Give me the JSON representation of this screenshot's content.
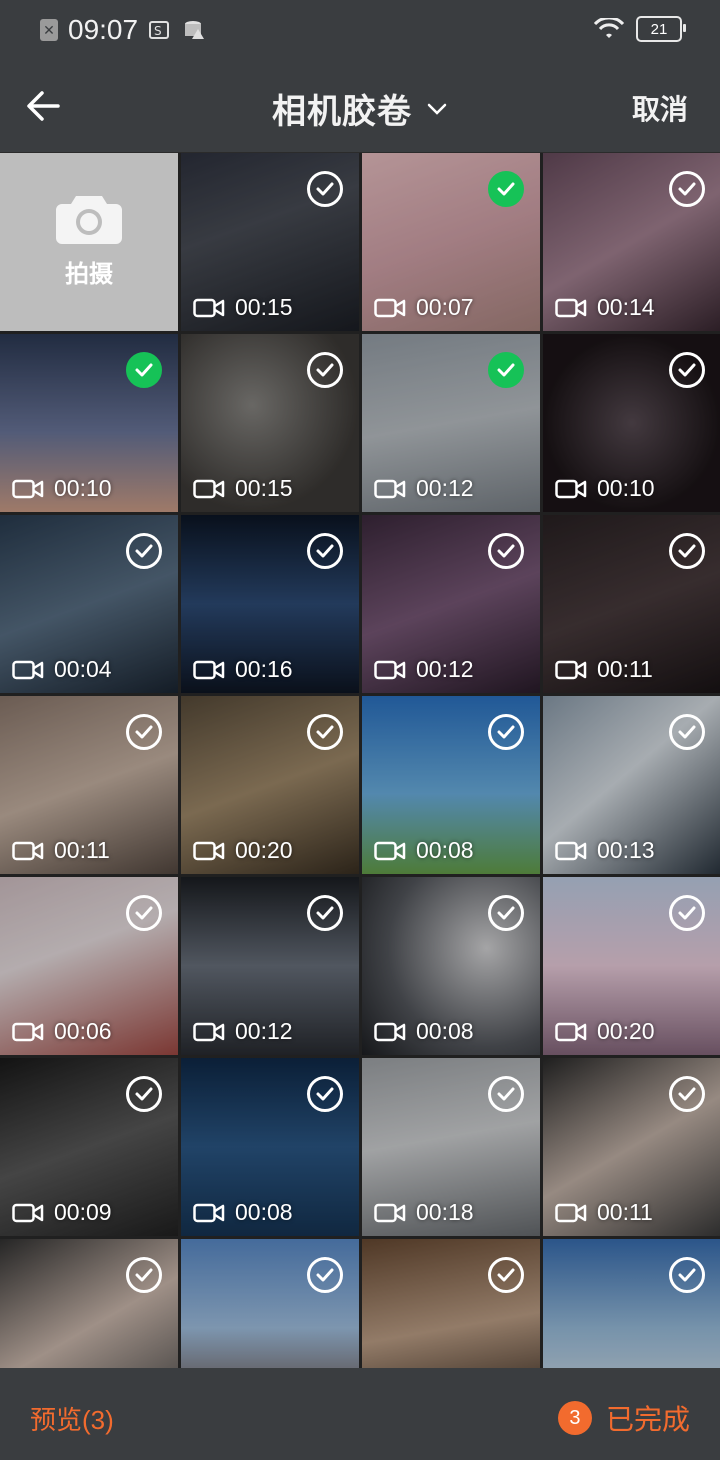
{
  "status": {
    "time": "09:07",
    "battery": "21"
  },
  "header": {
    "title": "相机胶卷",
    "cancel": "取消"
  },
  "camera_tile": {
    "label": "拍摄"
  },
  "videos": [
    {
      "duration": "00:15",
      "selected": false,
      "bg": "linear-gradient(160deg,#2f3340,#4b4f58 40%,#1c1f26)"
    },
    {
      "duration": "00:07",
      "selected": true,
      "bg": "linear-gradient(160deg,#f1c6c9,#d8a7ae 50%,#b08a84)"
    },
    {
      "duration": "00:14",
      "selected": false,
      "bg": "linear-gradient(150deg,#6a4d5f,#a98596 50%,#3a2832)"
    },
    {
      "duration": "00:10",
      "selected": true,
      "bg": "linear-gradient(180deg,#2d3b57,#6e7aa0 55%,#d4a38c)"
    },
    {
      "duration": "00:15",
      "selected": false,
      "bg": "radial-gradient(circle at 40% 40%,#8c8a86,#3e3b38 70%)"
    },
    {
      "duration": "00:12",
      "selected": true,
      "bg": "linear-gradient(170deg,#9ba4ad,#c0c6cb 50%,#7e858c)"
    },
    {
      "duration": "00:10",
      "selected": false,
      "bg": "radial-gradient(circle at 50% 50%,#5a4d55,#1c1518 70%)"
    },
    {
      "duration": "00:04",
      "selected": false,
      "bg": "linear-gradient(160deg,#2a3d52,#5b7288 50%,#1b2633)"
    },
    {
      "duration": "00:16",
      "selected": false,
      "bg": "linear-gradient(180deg,#0c1626,#2f4e7a 50%,#0e1624)"
    },
    {
      "duration": "00:12",
      "selected": false,
      "bg": "linear-gradient(160deg,#3d2a3e,#7b5a7a 50%,#2b1d2c)"
    },
    {
      "duration": "00:11",
      "selected": false,
      "bg": "linear-gradient(160deg,#2a2224,#4a3c3e 50%,#1a1416)"
    },
    {
      "duration": "00:11",
      "selected": false,
      "bg": "linear-gradient(160deg,#8f7b6f,#cdb8a8 50%,#574a42)"
    },
    {
      "duration": "00:20",
      "selected": false,
      "bg": "linear-gradient(160deg,#5a4d3b,#a48d6c 50%,#3b3022)"
    },
    {
      "duration": "00:08",
      "selected": false,
      "bg": "linear-gradient(180deg,#2c76c9,#6fb6e8 55%,#68a54c)"
    },
    {
      "duration": "00:13",
      "selected": false,
      "bg": "linear-gradient(140deg,#8fa0b0,#dfe6ec 45%,#2c3742)"
    },
    {
      "duration": "00:06",
      "selected": false,
      "bg": "linear-gradient(160deg,#d9c7cb,#f0e6e8 40%,#a44a44)"
    },
    {
      "duration": "00:12",
      "selected": false,
      "bg": "linear-gradient(180deg,#1c1f24,#6c7480 50%,#2a2d33)"
    },
    {
      "duration": "00:08",
      "selected": false,
      "bg": "radial-gradient(circle at 70% 40%,#dcdcde,#56595f 60%,#1e2024)"
    },
    {
      "duration": "00:20",
      "selected": false,
      "bg": "linear-gradient(180deg,#c7d6ee,#f3d4e4 50%,#8a6a80)"
    },
    {
      "duration": "00:09",
      "selected": false,
      "bg": "linear-gradient(160deg,#1a1a1a,#5c5c5c 50%,#222)"
    },
    {
      "duration": "00:08",
      "selected": false,
      "bg": "linear-gradient(180deg,#0f2a4a,#2c5a8a 50%,#163556)"
    },
    {
      "duration": "00:18",
      "selected": false,
      "bg": "linear-gradient(170deg,#a5a9ad,#d6d8da 45%,#6b6f73)"
    },
    {
      "duration": "00:11",
      "selected": false,
      "bg": "linear-gradient(150deg,#2a2a2a,#c9b8ad 50%,#3c3c3c)"
    },
    {
      "duration": "",
      "selected": false,
      "bg": "linear-gradient(150deg,#333,#d4c0b4 50%,#4a4a4a)"
    },
    {
      "duration": "",
      "selected": false,
      "bg": "linear-gradient(180deg,#5c8fcf,#a7c8ea 50%,#6a4a3a)"
    },
    {
      "duration": "",
      "selected": false,
      "bg": "linear-gradient(170deg,#6a4b33,#c4a58b 50%,#2d2017)"
    },
    {
      "duration": "",
      "selected": false,
      "bg": "linear-gradient(180deg,#3a72b8,#9ec4e4 50%,#e6eef4)"
    }
  ],
  "footer": {
    "preview": "预览(3)",
    "count": "3",
    "done": "已完成"
  },
  "colors": {
    "accent": "#f26b2e",
    "selected": "#16c257"
  }
}
